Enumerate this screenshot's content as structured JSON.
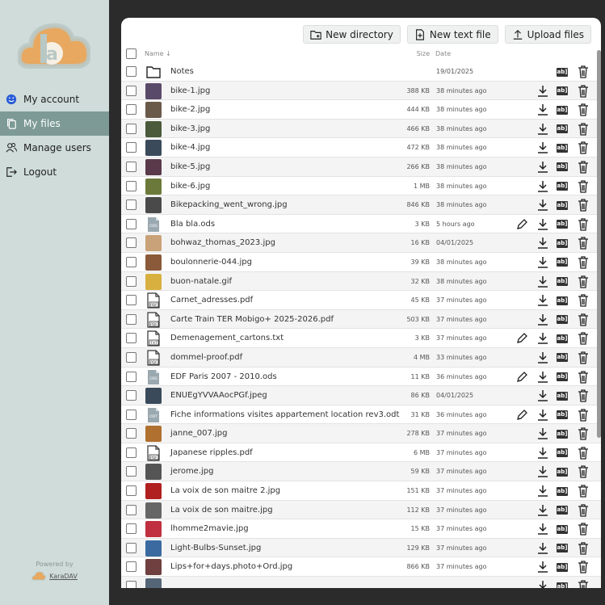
{
  "sidebar": {
    "nav": [
      {
        "label": "My account",
        "icon": "smiley-icon",
        "active": false
      },
      {
        "label": "My files",
        "icon": "copy-icon",
        "active": true
      },
      {
        "label": "Manage users",
        "icon": "users-icon",
        "active": false
      },
      {
        "label": "Logout",
        "icon": "logout-icon",
        "active": false
      }
    ],
    "powered_by": "Powered by",
    "brand": "KaraDAV"
  },
  "toolbar": {
    "new_directory": "New directory",
    "new_text_file": "New text file",
    "upload_files": "Upload files"
  },
  "table": {
    "headers": {
      "name": "Name ↓",
      "size": "Size",
      "date": "Date"
    },
    "rows": [
      {
        "name": "Notes",
        "size": "",
        "date": "19/01/2025",
        "kind": "folder",
        "thumb": "",
        "edit": false,
        "download": false
      },
      {
        "name": "bike-1.jpg",
        "size": "388 KB",
        "date": "38 minutes ago",
        "kind": "image",
        "thumb": "#5a4a6a",
        "edit": false,
        "download": true
      },
      {
        "name": "bike-2.jpg",
        "size": "444 KB",
        "date": "38 minutes ago",
        "kind": "image",
        "thumb": "#6a5a4a",
        "edit": false,
        "download": true
      },
      {
        "name": "bike-3.jpg",
        "size": "466 KB",
        "date": "38 minutes ago",
        "kind": "image",
        "thumb": "#4a5a3a",
        "edit": false,
        "download": true
      },
      {
        "name": "bike-4.jpg",
        "size": "472 KB",
        "date": "38 minutes ago",
        "kind": "image",
        "thumb": "#3a4a5a",
        "edit": false,
        "download": true
      },
      {
        "name": "bike-5.jpg",
        "size": "266 KB",
        "date": "38 minutes ago",
        "kind": "image",
        "thumb": "#5a3a4a",
        "edit": false,
        "download": true
      },
      {
        "name": "bike-6.jpg",
        "size": "1 MB",
        "date": "38 minutes ago",
        "kind": "image",
        "thumb": "#6b7a3a",
        "edit": false,
        "download": true
      },
      {
        "name": "Bikepacking_went_wrong.jpg",
        "size": "846 KB",
        "date": "38 minutes ago",
        "kind": "image",
        "thumb": "#4a4a4a",
        "edit": false,
        "download": true
      },
      {
        "name": "Bla bla.ods",
        "size": "3 KB",
        "date": "5 hours ago",
        "kind": "ods",
        "thumb": "",
        "edit": true,
        "download": true
      },
      {
        "name": "bohwaz_thomas_2023.jpg",
        "size": "16 KB",
        "date": "04/01/2025",
        "kind": "image",
        "thumb": "#c9a27a",
        "edit": false,
        "download": true
      },
      {
        "name": "boulonnerie-044.jpg",
        "size": "39 KB",
        "date": "38 minutes ago",
        "kind": "image",
        "thumb": "#8a5a3a",
        "edit": false,
        "download": true
      },
      {
        "name": "buon-natale.gif",
        "size": "32 KB",
        "date": "38 minutes ago",
        "kind": "image",
        "thumb": "#d8b040",
        "edit": false,
        "download": true
      },
      {
        "name": "Carnet_adresses.pdf",
        "size": "45 KB",
        "date": "37 minutes ago",
        "kind": "pdf",
        "thumb": "",
        "edit": false,
        "download": true
      },
      {
        "name": "Carte Train TER Mobigo+ 2025-2026.pdf",
        "size": "503 KB",
        "date": "37 minutes ago",
        "kind": "pdf",
        "thumb": "",
        "edit": false,
        "download": true
      },
      {
        "name": "Demenagement_cartons.txt",
        "size": "3 KB",
        "date": "37 minutes ago",
        "kind": "txt",
        "thumb": "",
        "edit": true,
        "download": true
      },
      {
        "name": "dommel-proof.pdf",
        "size": "4 MB",
        "date": "33 minutes ago",
        "kind": "pdf",
        "thumb": "",
        "edit": false,
        "download": true
      },
      {
        "name": "EDF Paris 2007 - 2010.ods",
        "size": "11 KB",
        "date": "36 minutes ago",
        "kind": "ods",
        "thumb": "",
        "edit": true,
        "download": true
      },
      {
        "name": "ENUEgYVVAAocPGf.jpeg",
        "size": "86 KB",
        "date": "04/01/2025",
        "kind": "image",
        "thumb": "#3a4a5a",
        "edit": false,
        "download": true
      },
      {
        "name": "Fiche informations visites appartement location rev3.odt",
        "size": "31 KB",
        "date": "36 minutes ago",
        "kind": "odt",
        "thumb": "",
        "edit": true,
        "download": true
      },
      {
        "name": "janne_007.jpg",
        "size": "278 KB",
        "date": "37 minutes ago",
        "kind": "image",
        "thumb": "#b07030",
        "edit": false,
        "download": true
      },
      {
        "name": "Japanese ripples.pdf",
        "size": "6 MB",
        "date": "37 minutes ago",
        "kind": "pdf",
        "thumb": "",
        "edit": false,
        "download": true
      },
      {
        "name": "jerome.jpg",
        "size": "59 KB",
        "date": "37 minutes ago",
        "kind": "image",
        "thumb": "#555555",
        "edit": false,
        "download": true
      },
      {
        "name": "La voix de son maitre 2.jpg",
        "size": "151 KB",
        "date": "37 minutes ago",
        "kind": "image",
        "thumb": "#b02020",
        "edit": false,
        "download": true
      },
      {
        "name": "La voix de son maitre.jpg",
        "size": "112 KB",
        "date": "37 minutes ago",
        "kind": "image",
        "thumb": "#666666",
        "edit": false,
        "download": true
      },
      {
        "name": "lhomme2mavie.jpg",
        "size": "15 KB",
        "date": "37 minutes ago",
        "kind": "image",
        "thumb": "#c03040",
        "edit": false,
        "download": true
      },
      {
        "name": "Light-Bulbs-Sunset.jpg",
        "size": "129 KB",
        "date": "37 minutes ago",
        "kind": "image",
        "thumb": "#3a6aa0",
        "edit": false,
        "download": true
      },
      {
        "name": "Lips+for+days.photo+Ord.jpg",
        "size": "866 KB",
        "date": "37 minutes ago",
        "kind": "image",
        "thumb": "#704040",
        "edit": false,
        "download": true
      },
      {
        "name": "",
        "size": "",
        "date": "",
        "kind": "image",
        "thumb": "#556677",
        "edit": false,
        "download": true
      }
    ]
  },
  "colors": {
    "sidebar_bg": "#cfdcd9",
    "active_nav": "#7d9a96",
    "panel_bg": "#ffffff",
    "page_bg": "#2b2b2b"
  }
}
